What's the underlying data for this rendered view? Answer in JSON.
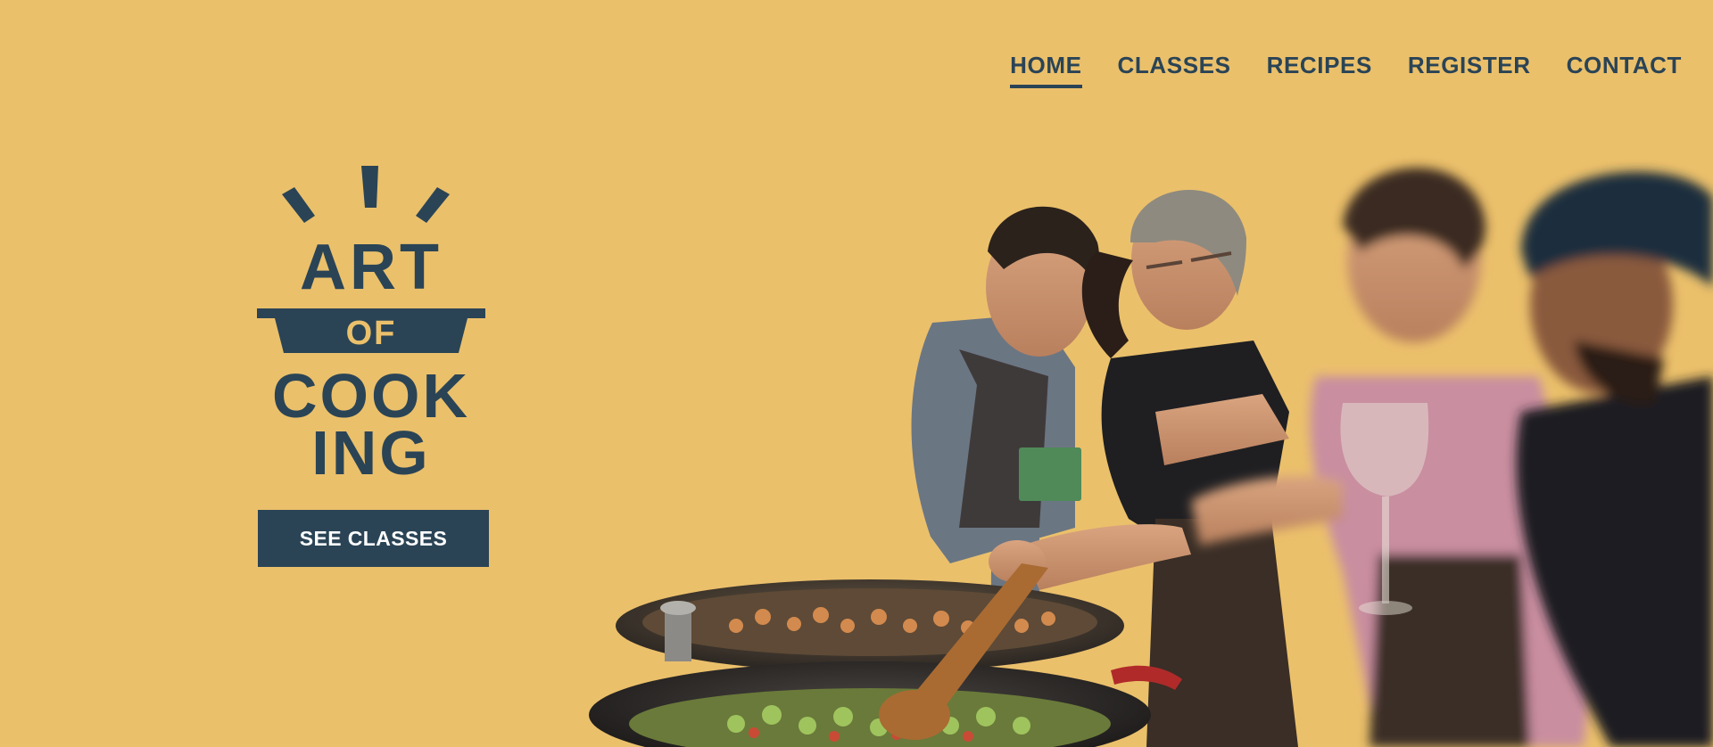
{
  "nav": {
    "items": [
      {
        "label": "HOME",
        "active": true
      },
      {
        "label": "CLASSES",
        "active": false
      },
      {
        "label": "RECIPES",
        "active": false
      },
      {
        "label": "REGISTER",
        "active": false
      },
      {
        "label": "CONTACT",
        "active": false
      }
    ]
  },
  "logo": {
    "line1": "ART",
    "line2": "OF",
    "line3": "COOK",
    "line4": "ING"
  },
  "cta": {
    "label": "SEE CLASSES"
  },
  "colors": {
    "background": "#EBC06B",
    "brand_dark": "#2A4456",
    "button_text": "#FFFFFF"
  }
}
